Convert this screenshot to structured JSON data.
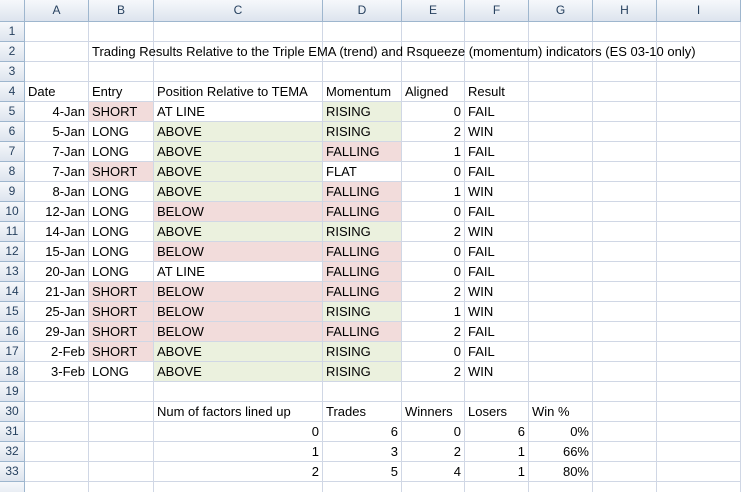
{
  "columns": [
    "A",
    "B",
    "C",
    "D",
    "E",
    "F",
    "G",
    "H",
    "I"
  ],
  "row_numbers": [
    "1",
    "2",
    "3",
    "4",
    "5",
    "6",
    "7",
    "8",
    "9",
    "10",
    "11",
    "12",
    "13",
    "14",
    "15",
    "16",
    "17",
    "18",
    "19",
    "30",
    "31",
    "32",
    "33",
    ""
  ],
  "title": "Trading Results Relative to the Triple EMA (trend) and Rsqueeze (momentum) indicators (ES 03-10 only)",
  "headers": [
    "Date",
    "Entry",
    "Position Relative to TEMA",
    "Momentum",
    "Aligned",
    "Result"
  ],
  "trades": [
    {
      "date": "4-Jan",
      "entry": "SHORT",
      "position": "AT LINE",
      "momentum": "RISING",
      "aligned": "0",
      "result": "FAIL"
    },
    {
      "date": "5-Jan",
      "entry": "LONG",
      "position": "ABOVE",
      "momentum": "RISING",
      "aligned": "2",
      "result": "WIN"
    },
    {
      "date": "7-Jan",
      "entry": "LONG",
      "position": "ABOVE",
      "momentum": "FALLING",
      "aligned": "1",
      "result": "FAIL"
    },
    {
      "date": "7-Jan",
      "entry": "SHORT",
      "position": "ABOVE",
      "momentum": "FLAT",
      "aligned": "0",
      "result": "FAIL"
    },
    {
      "date": "8-Jan",
      "entry": "LONG",
      "position": "ABOVE",
      "momentum": "FALLING",
      "aligned": "1",
      "result": "WIN"
    },
    {
      "date": "12-Jan",
      "entry": "LONG",
      "position": "BELOW",
      "momentum": "FALLING",
      "aligned": "0",
      "result": "FAIL"
    },
    {
      "date": "14-Jan",
      "entry": "LONG",
      "position": "ABOVE",
      "momentum": "RISING",
      "aligned": "2",
      "result": "WIN"
    },
    {
      "date": "15-Jan",
      "entry": "LONG",
      "position": "BELOW",
      "momentum": "FALLING",
      "aligned": "0",
      "result": "FAIL"
    },
    {
      "date": "20-Jan",
      "entry": "LONG",
      "position": "AT LINE",
      "momentum": "FALLING",
      "aligned": "0",
      "result": "FAIL"
    },
    {
      "date": "21-Jan",
      "entry": "SHORT",
      "position": "BELOW",
      "momentum": "FALLING",
      "aligned": "2",
      "result": "WIN"
    },
    {
      "date": "25-Jan",
      "entry": "SHORT",
      "position": "BELOW",
      "momentum": "RISING",
      "aligned": "1",
      "result": "WIN"
    },
    {
      "date": "29-Jan",
      "entry": "SHORT",
      "position": "BELOW",
      "momentum": "FALLING",
      "aligned": "2",
      "result": "FAIL"
    },
    {
      "date": "2-Feb",
      "entry": "SHORT",
      "position": "ABOVE",
      "momentum": "RISING",
      "aligned": "0",
      "result": "FAIL"
    },
    {
      "date": "3-Feb",
      "entry": "LONG",
      "position": "ABOVE",
      "momentum": "RISING",
      "aligned": "2",
      "result": "WIN"
    }
  ],
  "summary": {
    "headers": [
      "Num of factors lined up",
      "Trades",
      "Winners",
      "Losers",
      "Win %"
    ],
    "rows": [
      [
        "0",
        "6",
        "0",
        "6",
        "0%"
      ],
      [
        "1",
        "3",
        "2",
        "1",
        "66%"
      ],
      [
        "2",
        "5",
        "4",
        "1",
        "80%"
      ]
    ]
  },
  "colors": {
    "short_highlight": "#f2dcdb",
    "long_highlight": "#ebf1de",
    "grid": "#d0d7e5",
    "header_text": "#27415f"
  }
}
